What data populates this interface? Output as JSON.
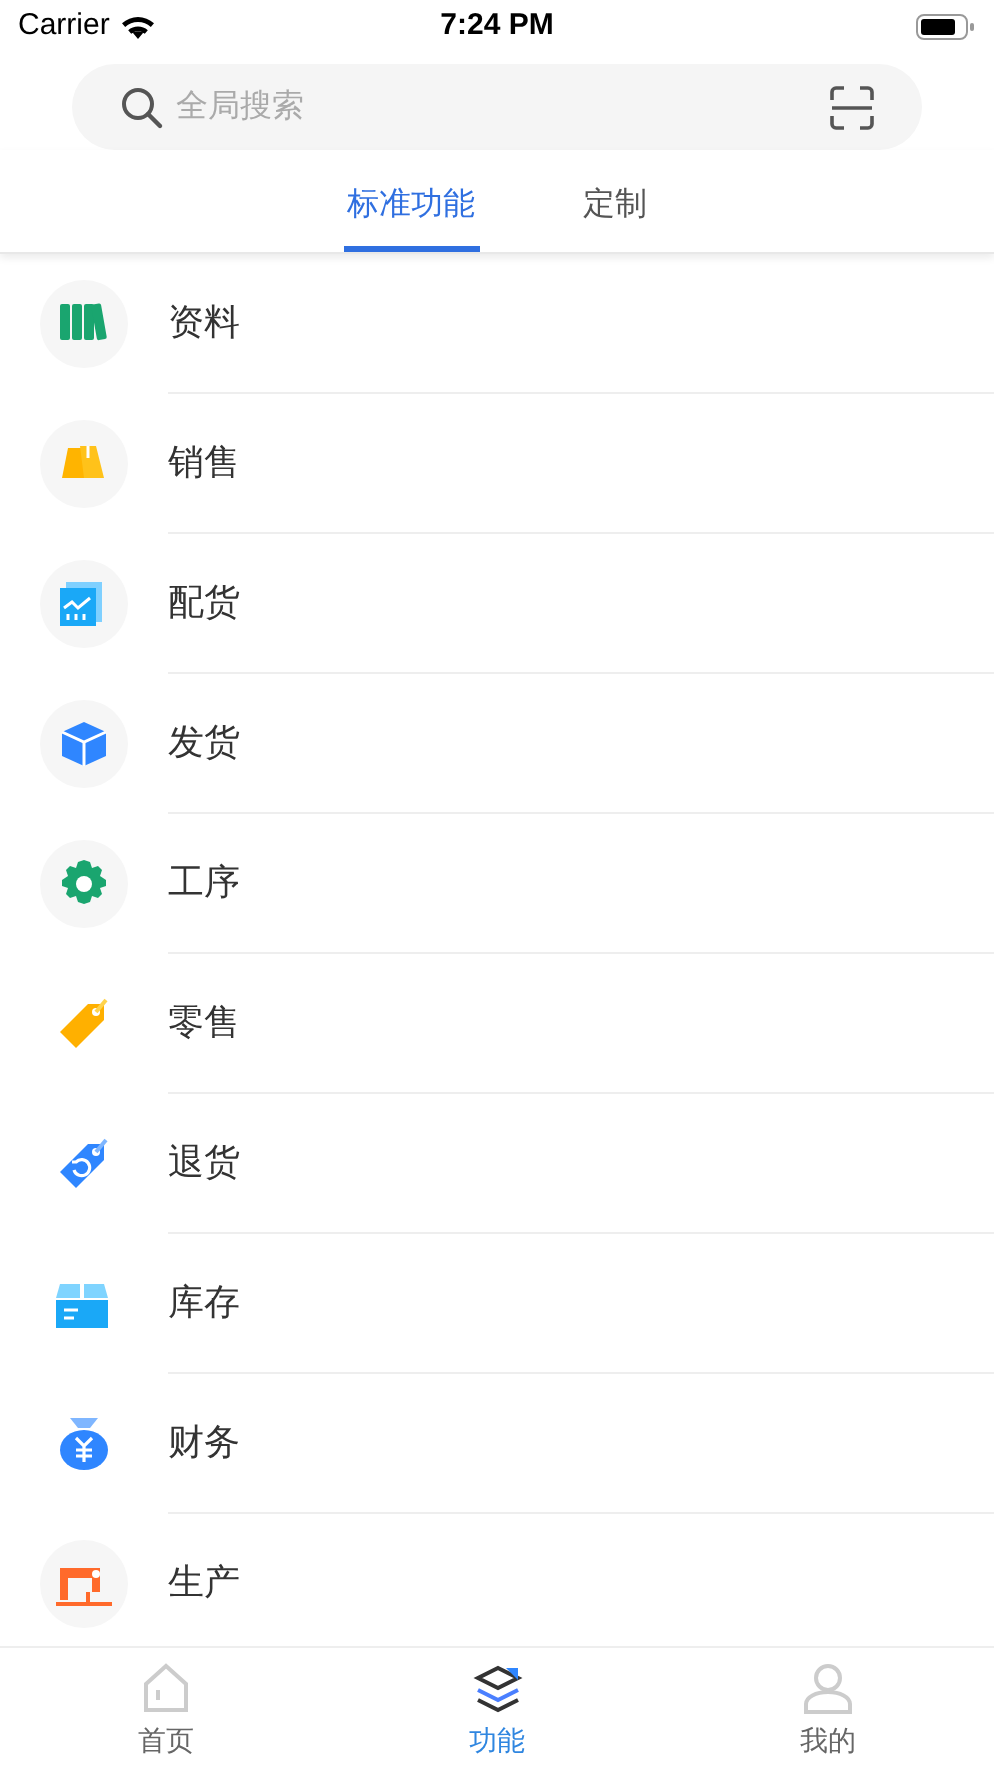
{
  "status_bar": {
    "carrier": "Carrier",
    "time": "7:24 PM"
  },
  "search": {
    "placeholder": "全局搜索"
  },
  "tabs": [
    {
      "label": "标准功能",
      "selected": true
    },
    {
      "label": "定制",
      "selected": false
    }
  ],
  "items": [
    {
      "label": "资料",
      "kind": "books"
    },
    {
      "label": "销售",
      "kind": "bags"
    },
    {
      "label": "配货",
      "kind": "chart"
    },
    {
      "label": "发货",
      "kind": "box"
    },
    {
      "label": "工序",
      "kind": "gear"
    },
    {
      "label": "零售",
      "kind": "tag"
    },
    {
      "label": "退货",
      "kind": "return"
    },
    {
      "label": "库存",
      "kind": "storage"
    },
    {
      "label": "财务",
      "kind": "money"
    },
    {
      "label": "生产",
      "kind": "sewing"
    }
  ],
  "tab_bar": [
    {
      "label": "首页",
      "kind": "home",
      "selected": false
    },
    {
      "label": "功能",
      "kind": "layers",
      "selected": true
    },
    {
      "label": "我的",
      "kind": "person",
      "selected": false
    }
  ]
}
